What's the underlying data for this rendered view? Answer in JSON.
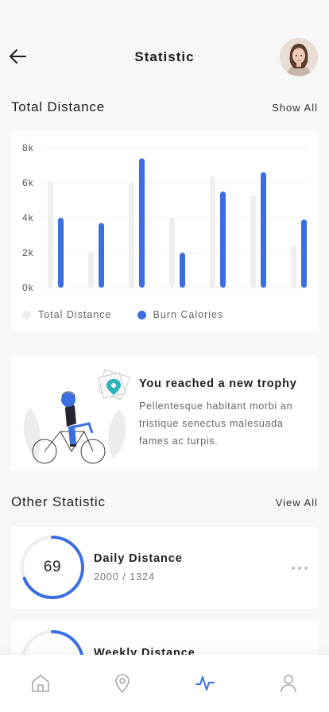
{
  "header": {
    "title": "Statistic"
  },
  "total_distance": {
    "title": "Total Distance",
    "link": "Show All"
  },
  "chart_data": {
    "type": "bar",
    "y_ticks": [
      "8k",
      "6k",
      "4k",
      "2k",
      "0k"
    ],
    "ylim": [
      0,
      8000
    ],
    "grid": true,
    "series": [
      {
        "name": "Total Distance",
        "color": "#efefef",
        "values": [
          6100,
          2100,
          6000,
          4000,
          6400,
          5300,
          2400
        ]
      },
      {
        "name": "Burn Calories",
        "color": "#3b6fe0",
        "values": [
          4000,
          3700,
          7400,
          2000,
          5500,
          6600,
          3900
        ]
      }
    ],
    "legend_position": "bottom-left"
  },
  "trophy": {
    "title": "You reached a new trophy",
    "text": "Pellentesque habitant morbi an tristique senectus malesuada fames ac turpis."
  },
  "other_statistic": {
    "title": "Other Statistic",
    "link": "View All"
  },
  "stats": [
    {
      "value": "69",
      "name": "Daily Distance",
      "sub": "2000 / 1324",
      "progress": 0.69
    },
    {
      "value": "",
      "name": "Weekly Distance",
      "sub": "",
      "progress": 0.6
    }
  ],
  "colors": {
    "accent": "#3b6fe0",
    "track": "#eeeeee",
    "background": "#f7f7f7"
  },
  "nav": {
    "items": [
      "home-icon",
      "location-pin-icon",
      "activity-icon",
      "profile-icon"
    ],
    "active": "activity-icon"
  }
}
